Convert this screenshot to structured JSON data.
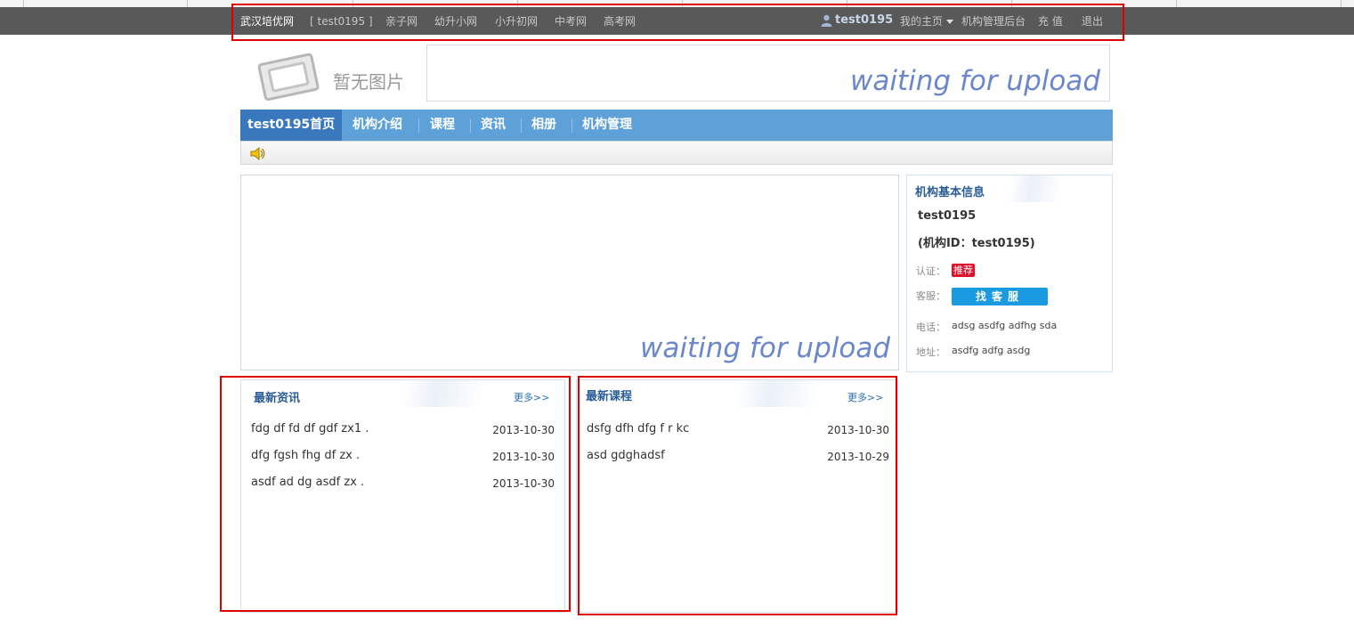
{
  "topbar": {
    "site": "武汉培优网",
    "current": "[ test0195 ]",
    "links": [
      "亲子网",
      "幼升小网",
      "小升初网",
      "中考网",
      "高考网"
    ],
    "user": "test0195",
    "my_home": "我的主页",
    "admin": "机构管理后台",
    "recharge": "充 值",
    "logout": "退出"
  },
  "logo": {
    "text": "暂无图片",
    "icon": "image-placeholder-icon"
  },
  "banner": {
    "text": "waiting for upload"
  },
  "nav": {
    "items": [
      "test0195首页",
      "机构介绍",
      "课程",
      "资讯",
      "相册",
      "机构管理"
    ],
    "active": 0
  },
  "notice": {
    "icon": "speaker-icon"
  },
  "slideshow": {
    "text": "waiting for upload"
  },
  "info": {
    "title": "机构基本信息",
    "name": "test0195",
    "id_line": "(机构ID：test0195)",
    "cert_label": "认证：",
    "cert_badge": "推荐",
    "service_label": "客服：",
    "service_button": "找客服",
    "phone_label": "电话：",
    "phone": "adsg asdfg adfhg sda",
    "address_label": "地址：",
    "address": "asdfg adfg asdg"
  },
  "news": {
    "title": "最新资讯",
    "more": "更多>>",
    "items": [
      {
        "title": "fdg df fd df gdf zx1 .",
        "date": "2013-10-30"
      },
      {
        "title": "dfg fgsh fhg df zx .",
        "date": "2013-10-30"
      },
      {
        "title": "asdf ad dg asdf zx .",
        "date": "2013-10-30"
      }
    ]
  },
  "courses": {
    "title": "最新课程",
    "more": "更多>>",
    "items": [
      {
        "title": "dsfg dfh dfg f r kc",
        "date": "2013-10-30"
      },
      {
        "title": "asd gdghadsf",
        "date": "2013-10-29"
      }
    ]
  },
  "colors": {
    "nav": "#5ea1d9",
    "nav_active": "#3a78be",
    "topbar": "#595959",
    "highlight_box": "#e00000"
  }
}
